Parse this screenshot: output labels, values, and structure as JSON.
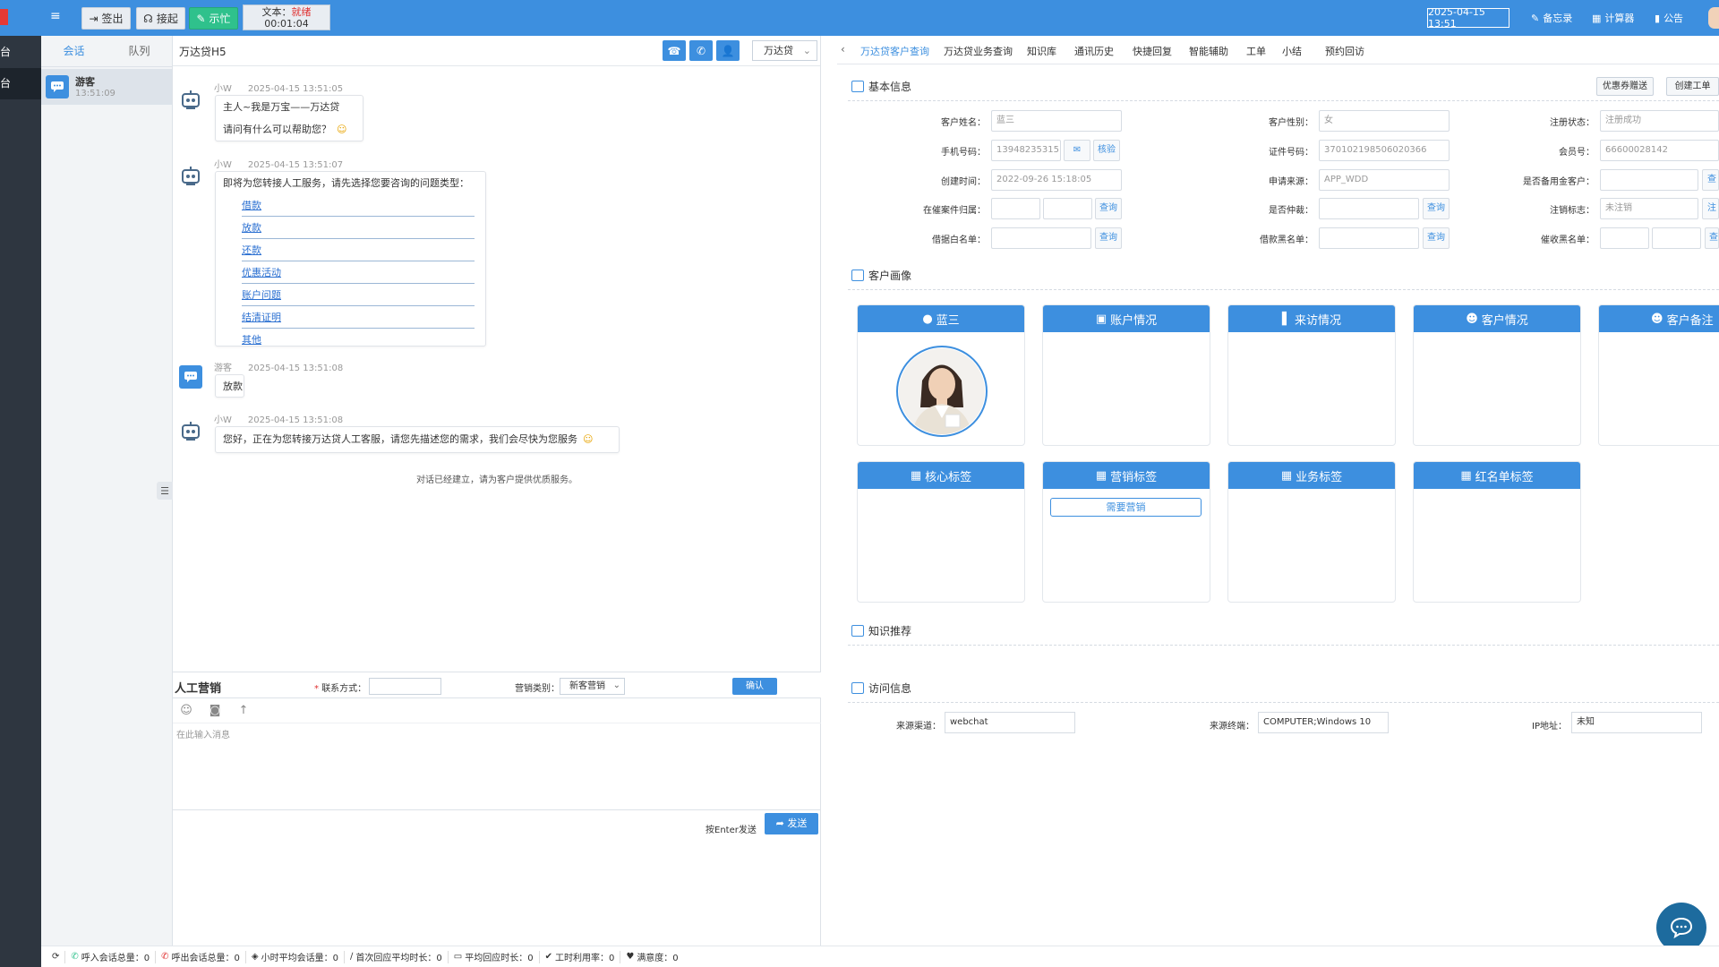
{
  "colors": {
    "primary": "#3d8fdf",
    "green": "#2fc18c",
    "dark": "#2e3640",
    "red": "#e03131"
  },
  "topbar": {
    "signout_label": "签出",
    "pickup_label": "接起",
    "busy_label": "示忙",
    "status_prefix": "文本：",
    "status_value": "就绪",
    "status_timer": "00:01:04",
    "datetime": "2025-04-15 13:51",
    "memo_label": "备忘录",
    "calculator_label": "计算器",
    "notice_label": "公告"
  },
  "leftnav": {
    "items": [
      {
        "label": "台"
      },
      {
        "label": "台"
      }
    ]
  },
  "conversations": {
    "tabs": [
      {
        "label": "会话"
      },
      {
        "label": "队列"
      }
    ],
    "items": [
      {
        "name": "游客",
        "time": "13:51:09"
      }
    ]
  },
  "chat": {
    "title": "万达贷H5",
    "channel_select": "万达贷",
    "messages": [
      {
        "sender": "小W",
        "time": "2025-04-15 13:51:05",
        "lines": [
          "主人~我是万宝——万达贷",
          "请问有什么可以帮助您？"
        ]
      },
      {
        "sender": "小W",
        "time": "2025-04-15 13:51:07",
        "intro": "即将为您转接人工服务，请先选择您要咨询的问题类型：",
        "options": [
          "借款",
          "放款",
          "还款",
          "优惠活动",
          "账户问题",
          "结清证明",
          "其他"
        ]
      },
      {
        "sender": "游客",
        "time": "2025-04-15 13:51:08",
        "text": "放款"
      },
      {
        "sender": "小W",
        "time": "2025-04-15 13:51:08",
        "text": "您好，正在为您转接万达贷人工客服，请您先描述您的需求，我们会尽快为您服务"
      }
    ],
    "system_message": "对话已经建立，请为客户提供优质服务。"
  },
  "marketing": {
    "title": "人工营销",
    "contact_label": "联系方式：",
    "contact_required": "*",
    "category_label": "营销类别：",
    "category_value": "新客营销",
    "confirm_label": "确认"
  },
  "composer": {
    "placeholder": "在此输入消息",
    "enter_hint": "按Enter发送",
    "send_label": "发送"
  },
  "right": {
    "tabs": [
      {
        "label": "万达贷客户查询"
      },
      {
        "label": "万达贷业务查询"
      },
      {
        "label": "知识库"
      },
      {
        "label": "通讯历史"
      },
      {
        "label": "快捷回复"
      },
      {
        "label": "智能辅助"
      },
      {
        "label": "工单"
      },
      {
        "label": "小结"
      },
      {
        "label": "预约回访"
      }
    ],
    "basic_info": {
      "title": "基本信息",
      "coupon_button": "优惠券赠送",
      "create_ticket_button": "创建工单",
      "fields": {
        "name_label": "客户姓名：",
        "name_value": "蓝三",
        "gender_label": "客户性别：",
        "gender_value": "女",
        "reg_status_label": "注册状态：",
        "reg_status_value": "注册成功",
        "phone_label": "手机号码：",
        "phone_value": "13948235315",
        "verify_button": "核验",
        "id_label": "证件号码：",
        "id_value": "370102198506020366",
        "member_label": "会员号：",
        "member_value": "66600028142",
        "created_label": "创建时间：",
        "created_value": "2022-09-26 15:18:05",
        "source_label": "申请来源：",
        "source_value": "APP_WDD",
        "reserve_label": "是否备用金客户：",
        "case_label": "在催案件归属：",
        "query_label": "查询",
        "arbitration_label": "是否仲裁：",
        "cancel_flag_label": "注销标志：",
        "cancel_flag_value": "未注销",
        "whitelist_label": "借据白名单：",
        "blacklist_label": "借款黑名单：",
        "collect_blacklist_label": "催收黑名单："
      }
    },
    "portrait": {
      "title": "客户画像",
      "cards": [
        {
          "label": "蓝三"
        },
        {
          "label": "账户情况"
        },
        {
          "label": "来访情况"
        },
        {
          "label": "客户情况"
        },
        {
          "label": "客户备注"
        }
      ],
      "tag_cards": [
        {
          "label": "核心标签"
        },
        {
          "label": "营销标签"
        },
        {
          "label": "业务标签"
        },
        {
          "label": "红名单标签"
        }
      ],
      "marketing_tag": "需要营销"
    },
    "knowledge": {
      "title": "知识推荐"
    },
    "visit": {
      "title": "访问信息",
      "channel_label": "来源渠道：",
      "channel_value": "webchat",
      "terminal_label": "来源终端：",
      "terminal_value": "COMPUTER;Windows 10",
      "ip_label": "IP地址：",
      "ip_value": "未知"
    }
  },
  "statusbar": {
    "items": [
      {
        "label": "呼入会话总量：0"
      },
      {
        "label": "呼出会话总量：0"
      },
      {
        "label": "小时平均会话量：0"
      },
      {
        "label": "首次回应平均时长：0"
      },
      {
        "label": "平均回应时长：0"
      },
      {
        "label": "工时利用率：0"
      },
      {
        "label": "满意度：0"
      }
    ]
  }
}
